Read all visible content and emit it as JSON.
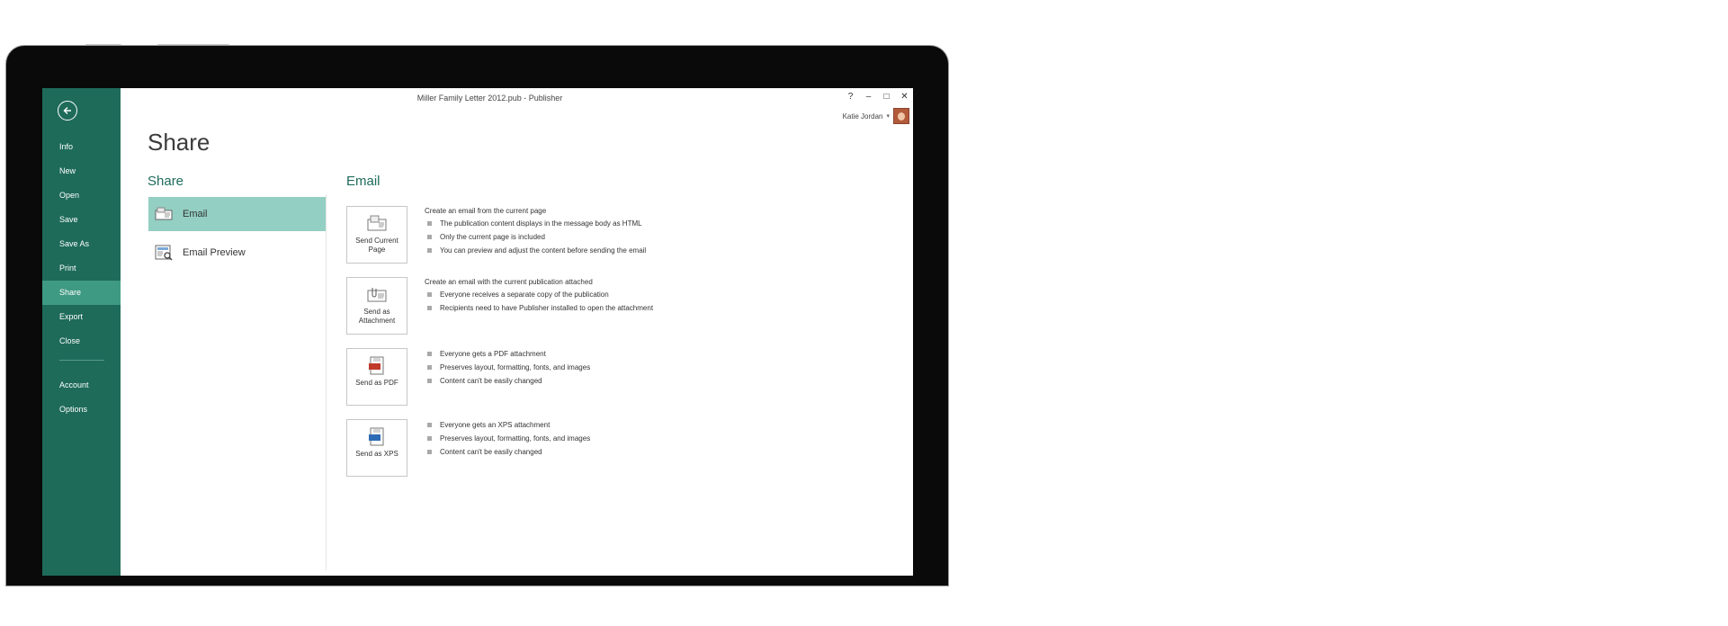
{
  "window": {
    "doc_title": "Miller Family Letter 2012.pub - Publisher",
    "controls": {
      "help": "?",
      "minimize": "–",
      "restore": "□",
      "close": "✕"
    },
    "user_name": "Katie Jordan",
    "user_caret": "▾"
  },
  "sidebar": {
    "items": [
      {
        "label": "Info"
      },
      {
        "label": "New"
      },
      {
        "label": "Open"
      },
      {
        "label": "Save"
      },
      {
        "label": "Save As"
      },
      {
        "label": "Print"
      },
      {
        "label": "Share",
        "active": true
      },
      {
        "label": "Export"
      },
      {
        "label": "Close"
      }
    ],
    "bottom_items": [
      {
        "label": "Account"
      },
      {
        "label": "Options"
      }
    ]
  },
  "main": {
    "title": "Share",
    "share_heading": "Share",
    "share_items": [
      {
        "label": "Email",
        "icon": "email-icon",
        "active": true
      },
      {
        "label": "Email Preview",
        "icon": "email-preview-icon"
      }
    ],
    "email_heading": "Email",
    "options": [
      {
        "label": "Send Current Page",
        "icon": "send-current-page-icon",
        "title": "Create an email from the current page",
        "bullets": [
          "The publication content displays in the message body as HTML",
          "Only the current page is included",
          "You can preview and adjust the content before sending the email"
        ]
      },
      {
        "label": "Send as Attachment",
        "icon": "attachment-icon",
        "title": "Create an email with the current publication attached",
        "bullets": [
          "Everyone receives a separate copy of the publication",
          "Recipients need to have Publisher installed to open the attachment"
        ]
      },
      {
        "label": "Send as PDF",
        "icon": "pdf-icon",
        "title": "",
        "bullets": [
          "Everyone gets a PDF attachment",
          "Preserves layout, formatting, fonts, and images",
          "Content can't be easily changed"
        ]
      },
      {
        "label": "Send as XPS",
        "icon": "xps-icon",
        "title": "",
        "bullets": [
          "Everyone gets an XPS attachment",
          "Preserves layout, formatting, fonts, and images",
          "Content can't be easily changed"
        ]
      }
    ]
  },
  "colors": {
    "sidebar": "#1e6b5a",
    "sidebar_active": "#3f9a83",
    "accent": "#1e6b5a",
    "selected_item": "#93cfc2"
  }
}
